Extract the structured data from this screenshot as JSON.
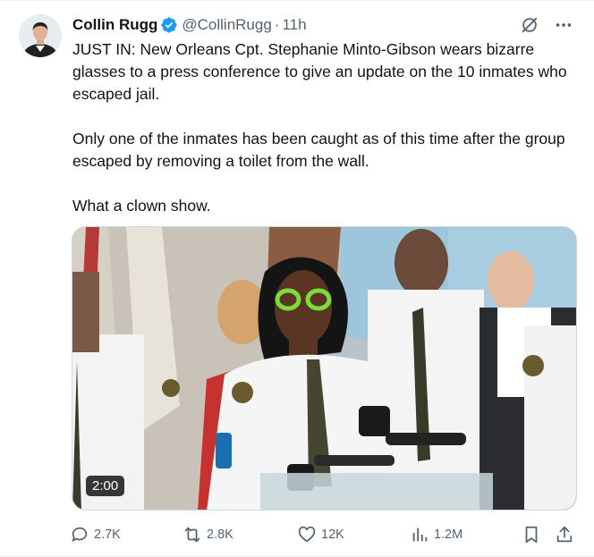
{
  "author": {
    "name": "Collin Rugg",
    "handle": "@CollinRugg",
    "separator": "·",
    "time": "11h",
    "avatar_icon": "person-avatar",
    "verified_icon": "verified-badge-icon",
    "verified_color": "#1d9bf0"
  },
  "tweet": {
    "paragraphs": [
      "JUST IN: New Orleans Cpt. Stephanie Minto-Gibson wears bizarre glasses to a press conference to give an update on the 10 inmates who escaped jail.",
      "Only one of the inmates has been caught as of this time after the group escaped by removing a toilet from the wall.",
      "What a clown show."
    ]
  },
  "media": {
    "type": "video",
    "duration": "2:00"
  },
  "actions": {
    "replies": "2.7K",
    "reposts": "2.8K",
    "likes": "12K",
    "views": "1.2M"
  },
  "top_icons": [
    "grok-icon",
    "more-icon"
  ],
  "colors": {
    "text": "#0f1419",
    "secondary": "#536471",
    "border": "#cfd9de"
  }
}
